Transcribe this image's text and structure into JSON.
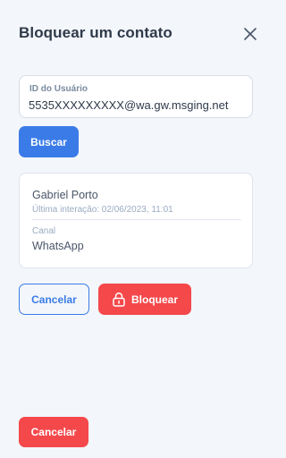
{
  "header": {
    "title": "Bloquear um contato",
    "close_icon": "close-icon"
  },
  "user_id_field": {
    "label": "ID do Usuário",
    "value": "5535XXXXXXXXX@wa.gw.msging.net"
  },
  "search_button": {
    "label": "Buscar"
  },
  "contact_card": {
    "name": "Gabriel Porto",
    "last_interaction": "Última interação: 02/06/2023, 11:01",
    "channel_label": "Canal",
    "channel_value": "WhatsApp"
  },
  "actions": {
    "cancel_label": "Cancelar",
    "block_label": "Bloquear",
    "block_icon": "lock-icon"
  },
  "footer": {
    "cancel_label": "Cancelar"
  },
  "colors": {
    "background": "#f3f6fa",
    "primary": "#3a7be8",
    "danger": "#f4484b"
  }
}
